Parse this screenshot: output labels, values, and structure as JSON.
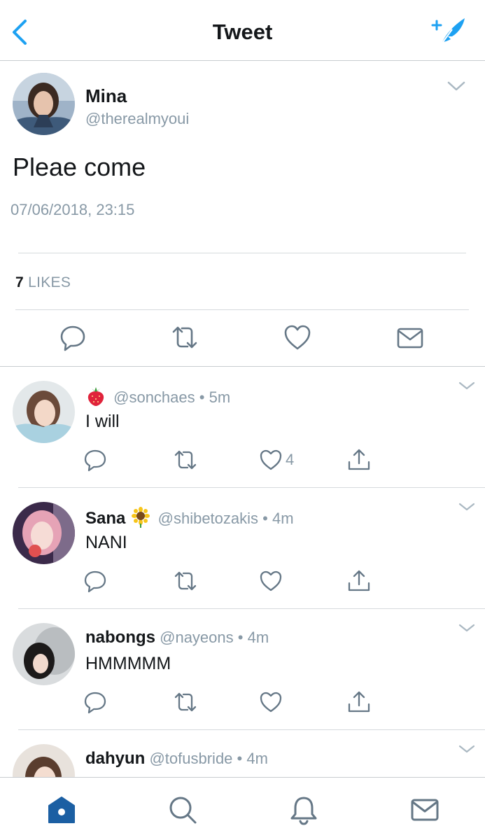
{
  "header": {
    "title": "Tweet",
    "back_icon": "chevron-left-icon",
    "compose_icon": "compose-tweet-icon"
  },
  "tweet": {
    "name": "Mina",
    "handle": "@therealmyoui",
    "text": "Pleae come",
    "timestamp": "07/06/2018, 23:15",
    "likes_count": "7",
    "likes_label": "LIKES"
  },
  "replies": [
    {
      "emoji": "strawberry",
      "name": "",
      "handle": "@sonchaes",
      "time": "5m",
      "text": "I will",
      "like_count": "4"
    },
    {
      "emoji": "sunflower",
      "name": "Sana",
      "handle": "@shibetozakis",
      "time": "4m",
      "text": "NANI",
      "like_count": ""
    },
    {
      "emoji": "",
      "name": "nabongs",
      "handle": "@nayeons",
      "time": "4m",
      "text": "HMMMMM",
      "like_count": ""
    },
    {
      "emoji": "",
      "name": "dahyun",
      "handle": "@tofusbride",
      "time": "4m",
      "text": "",
      "like_count": ""
    }
  ],
  "separator": "•",
  "tabbar": {
    "items": [
      "home-icon",
      "search-icon",
      "notifications-icon",
      "messages-icon"
    ]
  },
  "colors": {
    "accent": "#1da1f2",
    "secondary_text": "#8899a6",
    "tab_active": "#1b5fa3"
  }
}
